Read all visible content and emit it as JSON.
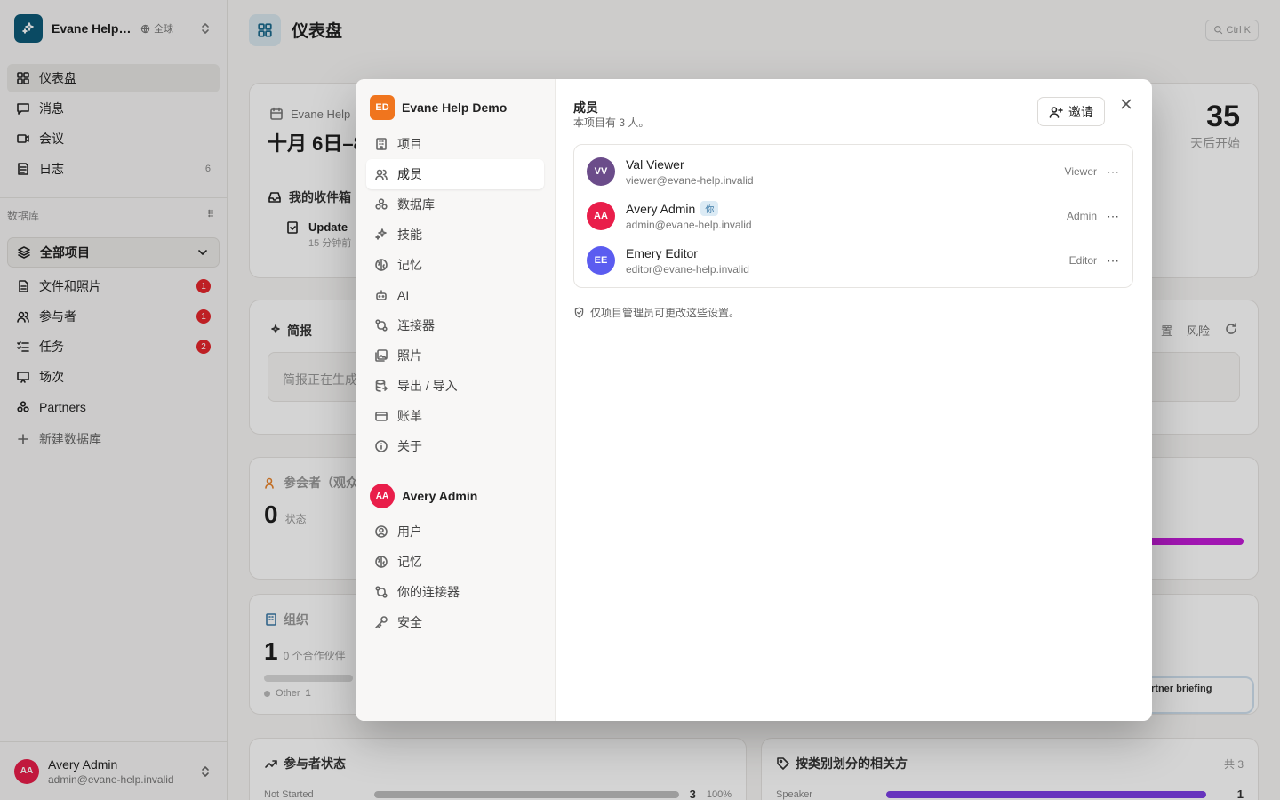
{
  "workspace": {
    "name": "Evane Help Demo",
    "scope": "全球"
  },
  "sidebar": {
    "nav": [
      {
        "label": "仪表盘",
        "icon": "grid-icon",
        "active": true
      },
      {
        "label": "消息",
        "icon": "message-icon"
      },
      {
        "label": "会议",
        "icon": "video-icon"
      },
      {
        "label": "日志",
        "icon": "log-icon",
        "count": "6"
      }
    ],
    "section_label": "数据库",
    "selector": "全部项目",
    "items": [
      {
        "label": "文件和照片",
        "badge": "1"
      },
      {
        "label": "参与者",
        "badge": "1"
      },
      {
        "label": "任务",
        "badge": "2"
      },
      {
        "label": "场次"
      },
      {
        "label": "Partners"
      }
    ],
    "new_db": "新建数据库",
    "user": {
      "initials": "AA",
      "name": "Avery Admin",
      "email": "admin@evane-help.invalid"
    }
  },
  "main": {
    "title": "仪表盘",
    "kbd": "Ctrl K",
    "countdown": {
      "value": "35",
      "label": "天后开始"
    },
    "card_date": {
      "label": "Evane Help",
      "date": "十月 6日–8"
    },
    "inbox": {
      "title": "我的收件箱",
      "item": "Update",
      "time": "15 分钟前"
    },
    "brief": {
      "title": "简报",
      "body": "简报正在生成",
      "tab1": "置",
      "tab2": "风险"
    },
    "attendees": {
      "title": "参会者（观众",
      "value": "0",
      "sub": "状态"
    },
    "orgs": {
      "title": "组织",
      "value": "1",
      "sub": "0 个合作伙伴",
      "legend": "Other",
      "legend_val": "1"
    },
    "briefing_tag": "e partner briefing",
    "status": {
      "title": "参与者状态",
      "row_label": "Not Started",
      "row_value": "3",
      "row_pct": "100%",
      "fill": 1.0
    },
    "stake": {
      "title": "按类别划分的相关方",
      "total": "共 3",
      "row_label": "Speaker",
      "row_value": "1"
    }
  },
  "modal": {
    "project": {
      "initials": "ED",
      "name": "Evane Help Demo"
    },
    "project_nav": [
      {
        "label": "项目",
        "icon": "building-icon"
      },
      {
        "label": "成员",
        "icon": "users-icon",
        "active": true
      },
      {
        "label": "数据库",
        "icon": "database-icon"
      },
      {
        "label": "技能",
        "icon": "sparkles-icon"
      },
      {
        "label": "记忆",
        "icon": "brain-icon"
      },
      {
        "label": "AI",
        "icon": "bot-icon"
      },
      {
        "label": "连接器",
        "icon": "connector-icon"
      },
      {
        "label": "照片",
        "icon": "photos-icon"
      },
      {
        "label": "导出 / 导入",
        "icon": "export-icon"
      },
      {
        "label": "账单",
        "icon": "card-icon"
      },
      {
        "label": "关于",
        "icon": "info-icon"
      }
    ],
    "user": {
      "initials": "AA",
      "name": "Avery Admin"
    },
    "user_nav": [
      {
        "label": "用户",
        "icon": "user-circle-icon"
      },
      {
        "label": "记忆",
        "icon": "brain-icon"
      },
      {
        "label": "你的连接器",
        "icon": "connector-icon"
      },
      {
        "label": "安全",
        "icon": "key-icon"
      }
    ],
    "content": {
      "title": "成员",
      "subtitle": "本项目有 3 人。",
      "invite": "邀请",
      "members": [
        {
          "initials": "VV",
          "name": "Val Viewer",
          "email": "viewer@evane-help.invalid",
          "role": "Viewer",
          "color": "#6b4c8a"
        },
        {
          "initials": "AA",
          "name": "Avery Admin",
          "email": "admin@evane-help.invalid",
          "role": "Admin",
          "you": "你",
          "color": "#e91e4a"
        },
        {
          "initials": "EE",
          "name": "Emery Editor",
          "email": "editor@evane-help.invalid",
          "role": "Editor",
          "color": "#5b5cf0"
        }
      ],
      "note": "仅项目管理员可更改这些设置。"
    }
  }
}
